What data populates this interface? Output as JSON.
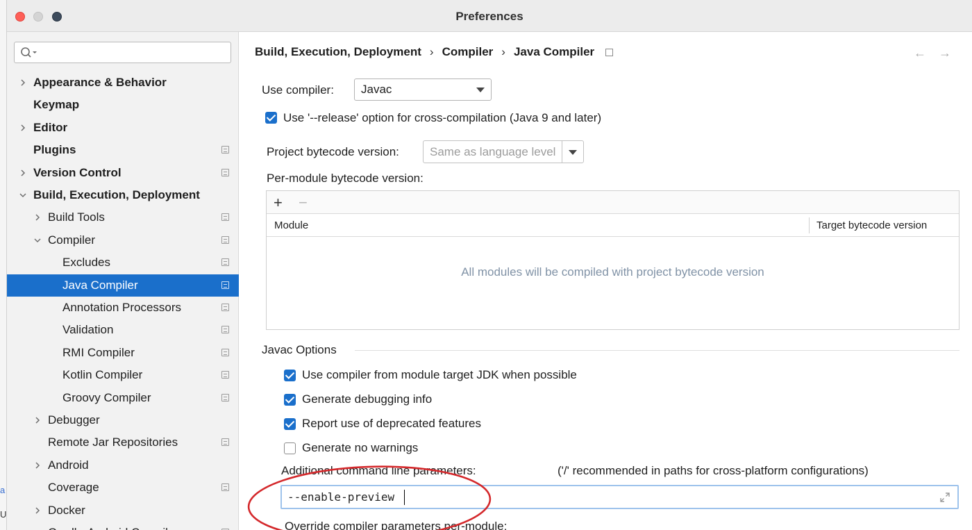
{
  "window": {
    "title": "Preferences"
  },
  "background_fragments": [
    "a",
    "U"
  ],
  "sidebar": {
    "search_placeholder": "",
    "items": [
      {
        "label": "Appearance & Behavior",
        "bold": true,
        "level": 0,
        "chevron": "right",
        "badge": false
      },
      {
        "label": "Keymap",
        "bold": true,
        "level": 0,
        "chevron": "",
        "badge": false
      },
      {
        "label": "Editor",
        "bold": true,
        "level": 0,
        "chevron": "right",
        "badge": false
      },
      {
        "label": "Plugins",
        "bold": true,
        "level": 0,
        "chevron": "",
        "badge": true
      },
      {
        "label": "Version Control",
        "bold": true,
        "level": 0,
        "chevron": "right",
        "badge": true
      },
      {
        "label": "Build, Execution, Deployment",
        "bold": true,
        "level": 0,
        "chevron": "down",
        "badge": false
      },
      {
        "label": "Build Tools",
        "bold": false,
        "level": 1,
        "chevron": "right",
        "badge": true
      },
      {
        "label": "Compiler",
        "bold": false,
        "level": 1,
        "chevron": "down",
        "badge": true
      },
      {
        "label": "Excludes",
        "bold": false,
        "level": 2,
        "chevron": "",
        "badge": true
      },
      {
        "label": "Java Compiler",
        "bold": false,
        "level": 2,
        "chevron": "",
        "badge": true,
        "selected": true
      },
      {
        "label": "Annotation Processors",
        "bold": false,
        "level": 2,
        "chevron": "",
        "badge": true
      },
      {
        "label": "Validation",
        "bold": false,
        "level": 2,
        "chevron": "",
        "badge": true
      },
      {
        "label": "RMI Compiler",
        "bold": false,
        "level": 2,
        "chevron": "",
        "badge": true
      },
      {
        "label": "Kotlin Compiler",
        "bold": false,
        "level": 2,
        "chevron": "",
        "badge": true
      },
      {
        "label": "Groovy Compiler",
        "bold": false,
        "level": 2,
        "chevron": "",
        "badge": true
      },
      {
        "label": "Debugger",
        "bold": false,
        "level": 1,
        "chevron": "right",
        "badge": false
      },
      {
        "label": "Remote Jar Repositories",
        "bold": false,
        "level": 1,
        "chevron": "",
        "badge": true
      },
      {
        "label": "Android",
        "bold": false,
        "level": 1,
        "chevron": "right",
        "badge": false
      },
      {
        "label": "Coverage",
        "bold": false,
        "level": 1,
        "chevron": "",
        "badge": true
      },
      {
        "label": "Docker",
        "bold": false,
        "level": 1,
        "chevron": "right",
        "badge": false
      },
      {
        "label": "Gradle-Android Compiler",
        "bold": false,
        "level": 1,
        "chevron": "",
        "badge": true
      }
    ]
  },
  "main": {
    "breadcrumb": [
      "Build, Execution, Deployment",
      "Compiler",
      "Java Compiler"
    ],
    "breadcrumb_separator": "›",
    "nav_back": "←",
    "nav_forward": "→",
    "use_compiler_label": "Use compiler:",
    "use_compiler_value": "Javac",
    "release_option_label": "Use '--release' option for cross-compilation (Java 9 and later)",
    "release_option_checked": true,
    "bytecode_label": "Project bytecode version:",
    "bytecode_placeholder": "Same as language level",
    "per_module_label": "Per-module bytecode version:",
    "table": {
      "add": "+",
      "remove": "−",
      "columns": [
        "Module",
        "Target bytecode version"
      ],
      "empty_text": "All modules will be compiled with project bytecode version"
    },
    "javac_options_title": "Javac Options",
    "javac_options": [
      {
        "label": "Use compiler from module target JDK when possible",
        "checked": true
      },
      {
        "label": "Generate debugging info",
        "checked": true
      },
      {
        "label": "Report use of deprecated features",
        "checked": true
      },
      {
        "label": "Generate no warnings",
        "checked": false
      }
    ],
    "additional_params_label": "Additional command line parameters:",
    "additional_params_hint": "('/' recommended in paths for cross-platform configurations)",
    "additional_params_value": "--enable-preview",
    "override_label": "Override compiler parameters per-module:"
  },
  "colors": {
    "selection": "#1a6fcb",
    "annotation": "#d4282b"
  }
}
